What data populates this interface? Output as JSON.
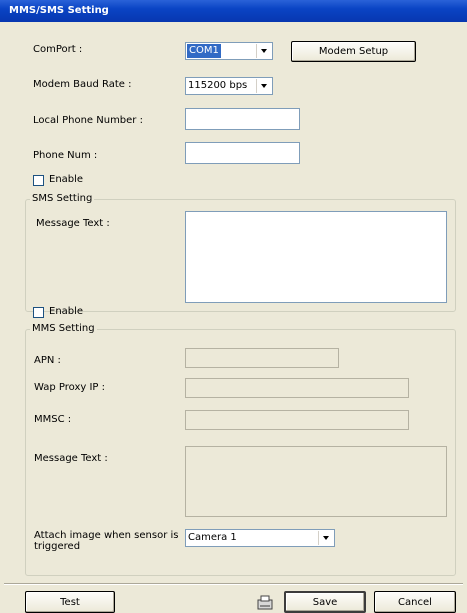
{
  "window": {
    "title": "MMS/SMS Setting"
  },
  "comport": {
    "label": "ComPort :",
    "value": "COM1",
    "modem_setup_label": "Modem Setup"
  },
  "baud": {
    "label": "Modem Baud Rate :",
    "value": "115200 bps"
  },
  "local_phone": {
    "label": "Local Phone Number :",
    "value": ""
  },
  "phone_num": {
    "label": "Phone Num :",
    "value": ""
  },
  "sms": {
    "enable_label": "Enable",
    "enabled": false,
    "group_label": "SMS Setting",
    "message_label": "Message Text :",
    "message_value": ""
  },
  "mms": {
    "enable_label": "Enable",
    "enabled": false,
    "group_label": "MMS Setting",
    "apn_label": "APN :",
    "wap_label": "Wap Proxy IP :",
    "mmsc_label": "MMSC :",
    "message_label": "Message Text :",
    "attach_label_line1": "Attach image when sensor is",
    "attach_label_line2": "triggered",
    "camera_value": "Camera 1"
  },
  "footer": {
    "test_label": "Test",
    "save_label": "Save",
    "cancel_label": "Cancel"
  },
  "icons": {
    "save_icon": "floppy-disk-icon"
  }
}
